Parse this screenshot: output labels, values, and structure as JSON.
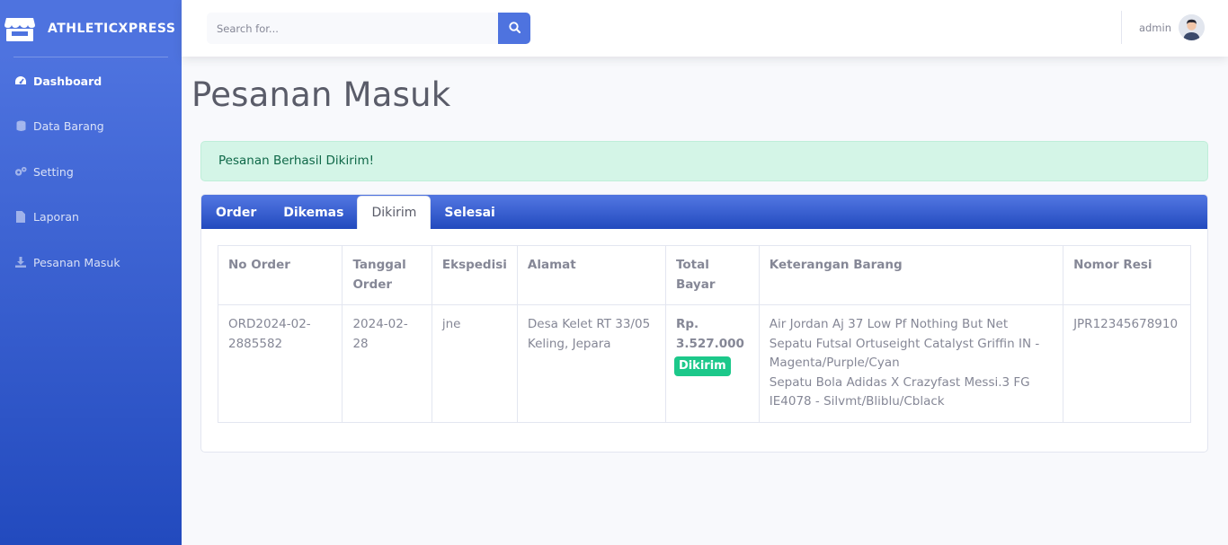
{
  "brand": {
    "name": "ATHLETICXPRESS",
    "icon": "store-icon"
  },
  "sidebar": {
    "items": [
      {
        "label": "Dashboard",
        "icon": "tachometer-icon",
        "active": true
      },
      {
        "label": "Data Barang",
        "icon": "database-icon",
        "active": false
      },
      {
        "label": "Setting",
        "icon": "cogs-icon",
        "active": false
      },
      {
        "label": "Laporan",
        "icon": "file-icon",
        "active": false
      },
      {
        "label": "Pesanan Masuk",
        "icon": "download-icon",
        "active": false
      }
    ]
  },
  "topbar": {
    "search_placeholder": "Search for...",
    "search_icon": "search-icon",
    "user_name": "admin"
  },
  "page": {
    "title": "Pesanan Masuk",
    "alert": "Pesanan Berhasil Dikirim!"
  },
  "tabs": [
    {
      "label": "Order",
      "active": false
    },
    {
      "label": "Dikemas",
      "active": false
    },
    {
      "label": "Dikirim",
      "active": true
    },
    {
      "label": "Selesai",
      "active": false
    }
  ],
  "table": {
    "headers": [
      "No Order",
      "Tanggal Order",
      "Ekspedisi",
      "Alamat",
      "Total Bayar",
      "Keterangan Barang",
      "Nomor Resi"
    ],
    "rows": [
      {
        "no_order": "ORD2024-02-2885582",
        "tanggal": "2024-02-28",
        "ekspedisi": "jne",
        "alamat": "Desa Kelet RT 33/05 Keling, Jepara",
        "total": "Rp. 3.527.000",
        "status": "Dikirim",
        "items": [
          "Air Jordan Aj 37 Low Pf Nothing But Net",
          "Sepatu Futsal Ortuseight Catalyst Griffin IN - Magenta/Purple/Cyan",
          "Sepatu Bola Adidas X Crazyfast Messi.3 FG IE4078 - Silvmt/Bliblu/Cblack"
        ],
        "resi": "JPR12345678910"
      }
    ]
  },
  "colors": {
    "primary": "#4e73df",
    "primary_dark": "#224abe",
    "success": "#1cc88a",
    "alert_bg": "#d4f5e7",
    "alert_text": "#0f6848"
  }
}
